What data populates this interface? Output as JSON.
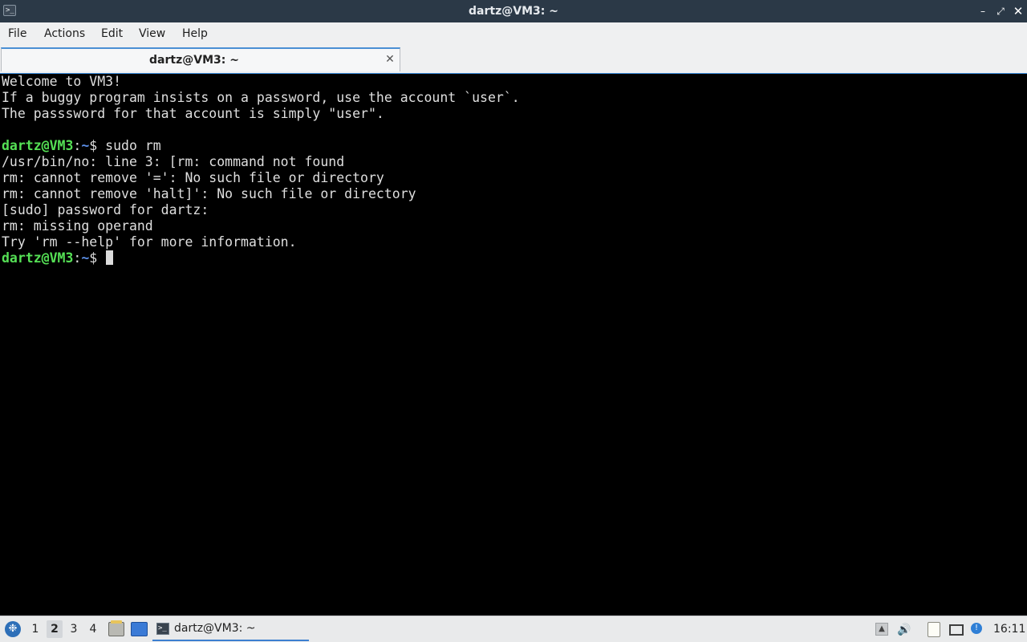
{
  "window": {
    "title": "dartz@VM3: ~",
    "app_icon": ">_",
    "controls": {
      "minimize": "–",
      "maximize": "⤢",
      "close": "✕"
    }
  },
  "menu": {
    "items": [
      "File",
      "Actions",
      "Edit",
      "View",
      "Help"
    ]
  },
  "tabs": [
    {
      "label": "dartz@VM3: ~",
      "close": "✕",
      "active": true
    }
  ],
  "terminal": {
    "lines": [
      {
        "text": "Welcome to VM3!"
      },
      {
        "text": "If a buggy program insists on a password, use the account `user`."
      },
      {
        "text": "The passsword for that account is simply \"user\"."
      },
      {
        "text": ""
      },
      {
        "prompt": {
          "user": "dartz@VM3",
          "sep": ":",
          "path": "~",
          "symbol": "$ "
        },
        "command": "sudo rm"
      },
      {
        "text": "/usr/bin/no: line 3: [rm: command not found"
      },
      {
        "text": "rm: cannot remove '=': No such file or directory"
      },
      {
        "text": "rm: cannot remove 'halt]': No such file or directory"
      },
      {
        "text": "[sudo] password for dartz:"
      },
      {
        "text": "rm: missing operand"
      },
      {
        "text": "Try 'rm --help' for more information."
      },
      {
        "prompt": {
          "user": "dartz@VM3",
          "sep": ":",
          "path": "~",
          "symbol": "$ "
        },
        "command": "",
        "cursor": true
      }
    ],
    "colors": {
      "background": "#000000",
      "foreground": "#dfdfdf",
      "prompt_user": "#55e055",
      "prompt_path": "#5b8ee6"
    }
  },
  "taskbar": {
    "start_icon": "start-menu-icon",
    "workspaces": [
      {
        "label": "1",
        "active": false
      },
      {
        "label": "2",
        "active": true
      },
      {
        "label": "3",
        "active": false
      },
      {
        "label": "4",
        "active": false
      }
    ],
    "quicklaunch": [
      "file-manager-icon",
      "show-desktop-icon"
    ],
    "tasks": [
      {
        "label": "dartz@VM3: ~",
        "icon": "terminal-icon",
        "active": true
      }
    ],
    "tray": [
      "tray-expand-icon",
      "volume-icon",
      "clipboard-icon",
      "network-icon",
      "update-notifier-icon"
    ],
    "clock": "16:11"
  },
  "colors": {
    "titlebar": "#2b3947",
    "accent": "#3c7fd0",
    "menubar": "#eff0f1"
  }
}
